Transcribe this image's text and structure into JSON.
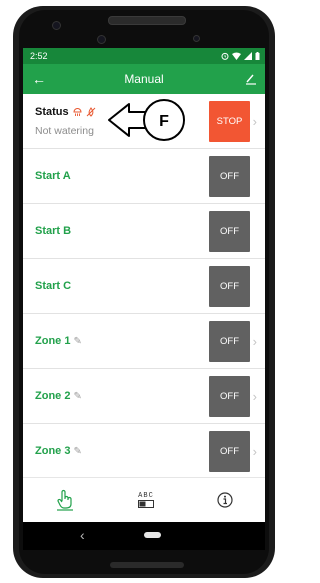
{
  "statusbar": {
    "time": "2:52",
    "alarm_icon": "alarm-icon",
    "wifi_icon": "wifi-icon",
    "signal_icon": "signal-icon",
    "battery_icon": "battery-icon"
  },
  "appbar": {
    "title": "Manual",
    "back_glyph": "←",
    "edit_glyph": "⁄"
  },
  "status_row": {
    "label": "Status",
    "subtitle": "Not watering",
    "button": "STOP",
    "callout_letter": "F"
  },
  "rows": [
    {
      "label": "Start A",
      "button": "OFF",
      "has_pencil": false,
      "has_chevron": false
    },
    {
      "label": "Start B",
      "button": "OFF",
      "has_pencil": false,
      "has_chevron": false
    },
    {
      "label": "Start C",
      "button": "OFF",
      "has_pencil": false,
      "has_chevron": false
    },
    {
      "label": "Zone 1",
      "button": "OFF",
      "has_pencil": true,
      "has_chevron": true
    },
    {
      "label": "Zone 2",
      "button": "OFF",
      "has_pencil": true,
      "has_chevron": true
    },
    {
      "label": "Zone 3",
      "button": "OFF",
      "has_pencil": true,
      "has_chevron": true
    }
  ],
  "bottomnav": {
    "abc_label": "ABC"
  },
  "colors": {
    "statusbar": "#17873a",
    "appbar": "#22a14b",
    "label_green": "#22a14b",
    "stop_red": "#f25633",
    "off_gray": "#616161"
  }
}
